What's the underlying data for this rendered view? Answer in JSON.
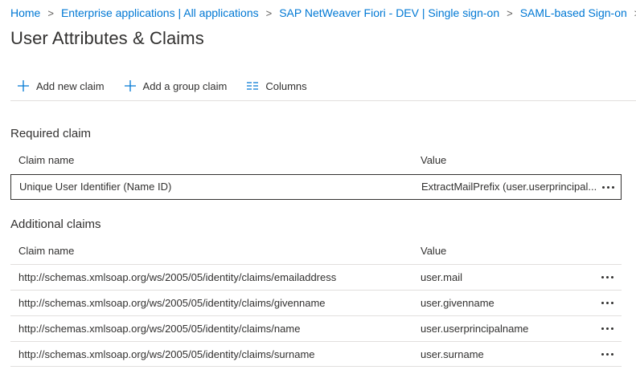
{
  "breadcrumb": [
    "Home",
    "Enterprise applications | All applications",
    "SAP NetWeaver Fiori - DEV | Single sign-on",
    "SAML-based Sign-on"
  ],
  "page_title": "User Attributes & Claims",
  "toolbar": {
    "add_new_claim": "Add new claim",
    "add_group_claim": "Add a group claim",
    "columns": "Columns"
  },
  "required": {
    "title": "Required claim",
    "header_name": "Claim name",
    "header_value": "Value",
    "rows": [
      {
        "name": "Unique User Identifier (Name ID)",
        "value": "ExtractMailPrefix (user.userprincipal..."
      }
    ]
  },
  "additional": {
    "title": "Additional claims",
    "header_name": "Claim name",
    "header_value": "Value",
    "rows": [
      {
        "name": "http://schemas.xmlsoap.org/ws/2005/05/identity/claims/emailaddress",
        "value": "user.mail"
      },
      {
        "name": "http://schemas.xmlsoap.org/ws/2005/05/identity/claims/givenname",
        "value": "user.givenname"
      },
      {
        "name": "http://schemas.xmlsoap.org/ws/2005/05/identity/claims/name",
        "value": "user.userprincipalname"
      },
      {
        "name": "http://schemas.xmlsoap.org/ws/2005/05/identity/claims/surname",
        "value": "user.surname"
      }
    ]
  },
  "icons": {
    "add": "plus-icon",
    "columns": "columns-icon",
    "more": "more-icon",
    "separator": "chevron-right-icon"
  },
  "colors": {
    "link": "#0078d4",
    "text": "#323130",
    "divider": "#e1dfdd"
  }
}
